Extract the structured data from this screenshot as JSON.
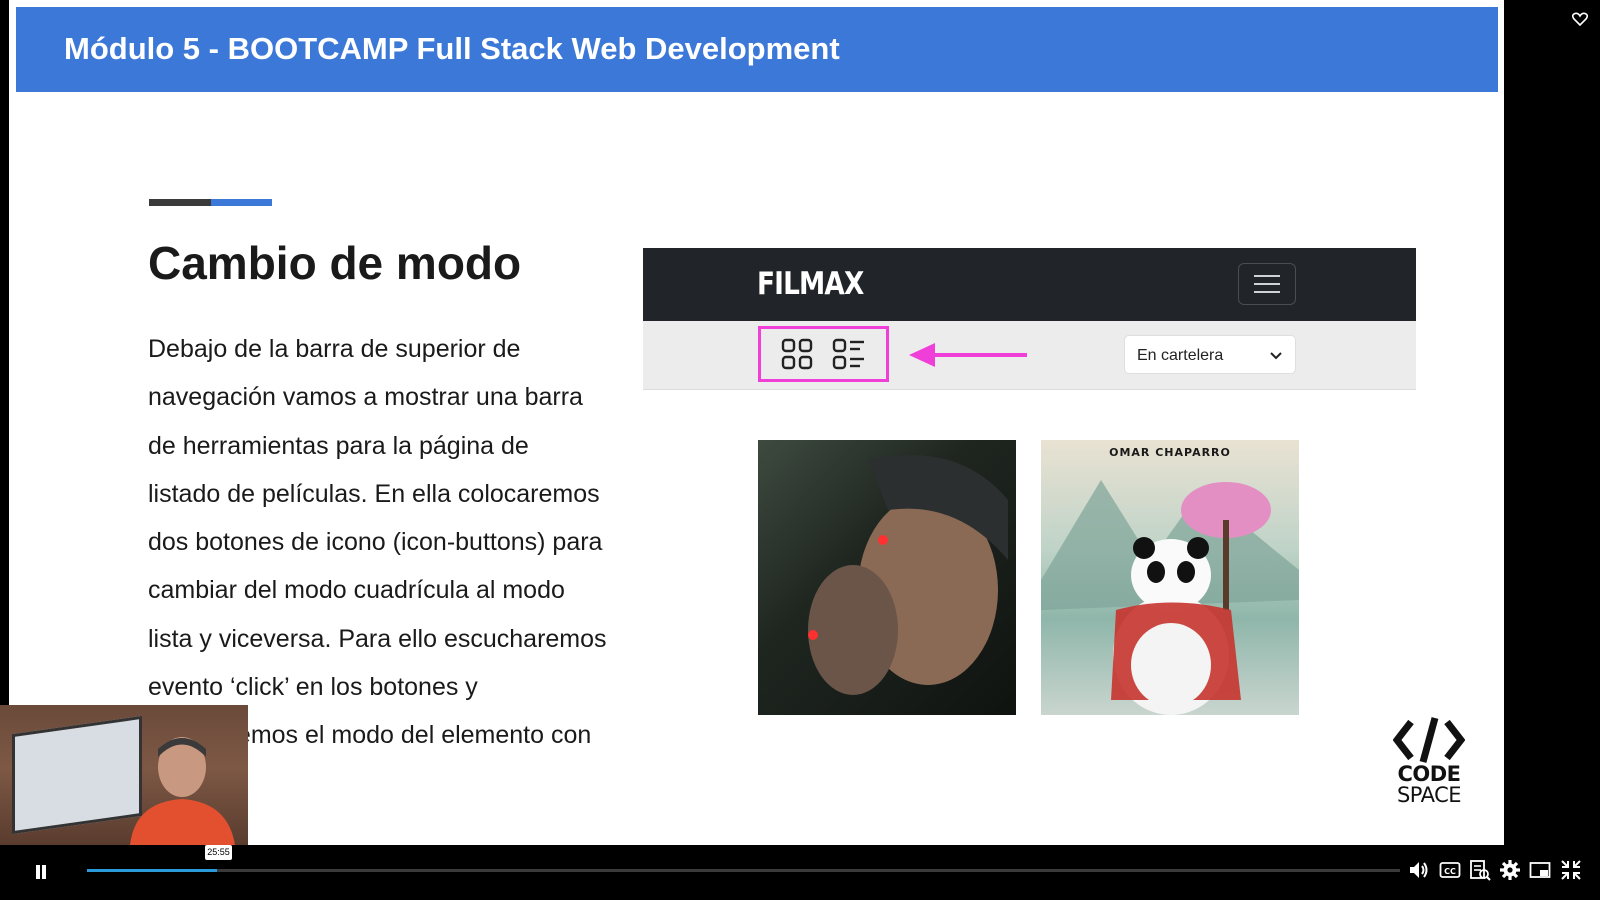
{
  "slide": {
    "header_title": "Módulo 5 - BOOTCAMP Full Stack Web Development",
    "heading": "Cambio de modo",
    "paragraph": "Debajo de la barra de superior de navegación vamos a mostrar una barra de herramientas para la página de listado de películas. En ella colocaremos dos botones de icono (icon-buttons) para cambiar del modo cuadrícula al modo lista y viceversa. Para ello escucharemos evento ‘click’ en los botones y cambiaremos el modo del elemento con el id",
    "colors": {
      "header": "#3b78d8",
      "accent_dark": "#3a3a3a",
      "accent_blue": "#3b78d8"
    }
  },
  "mockup": {
    "logo": "FILMAX",
    "select_value": "En cartelera",
    "poster_2_title": "OMAR CHAPARRO",
    "highlight_color": "#f03fd8",
    "icons": [
      "grid-icon",
      "list-icon",
      "hamburger-icon",
      "chevron-down-icon"
    ]
  },
  "brand": {
    "line1": "CODE",
    "line2": "SPACE"
  },
  "player": {
    "tooltip_time": "25:55",
    "progress_fraction": 0.099,
    "accent": "#2a9bd8",
    "icons": [
      "pause-icon",
      "volume-icon",
      "cc-icon",
      "transcript-icon",
      "gear-icon",
      "picture-in-picture-icon",
      "exit-fullscreen-icon",
      "heart-icon"
    ]
  }
}
